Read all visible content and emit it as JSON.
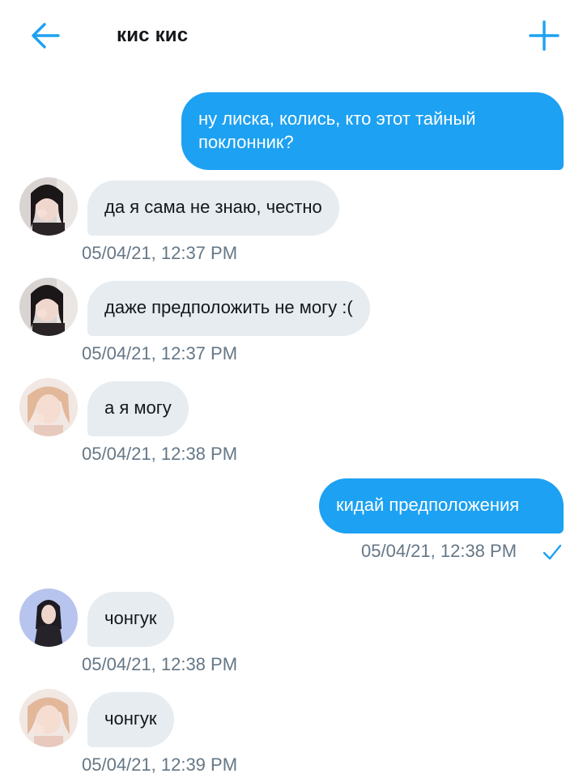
{
  "header": {
    "title": "кис кис",
    "back_icon": "arrow-left-icon",
    "add_icon": "plus-icon",
    "accent": "#1da1f2"
  },
  "messages": [
    {
      "direction": "sent",
      "text_line1": "ну лиска, колись, кто этот тайный",
      "text_line2": "поклонник?"
    },
    {
      "direction": "received",
      "text": "да я сама не знаю, честно",
      "time": "05/04/21, 12:37 PM"
    },
    {
      "direction": "received",
      "text": "даже предположить не могу :(",
      "time": "05/04/21, 12:37 PM"
    },
    {
      "direction": "received",
      "text": "а я могу",
      "time": "05/04/21, 12:38 PM"
    },
    {
      "direction": "sent",
      "text": "кидай предположения",
      "time": "05/04/21, 12:38 PM",
      "status_icon": "checkmark-icon"
    },
    {
      "direction": "received",
      "text": "чонгук",
      "time": "05/04/21, 12:38 PM"
    },
    {
      "direction": "received",
      "text": "чонгук",
      "time": "05/04/21, 12:39 PM"
    }
  ],
  "colors": {
    "sent_bubble": "#1da1f2",
    "received_bubble": "#e6ecf0",
    "timestamp": "#657786"
  }
}
